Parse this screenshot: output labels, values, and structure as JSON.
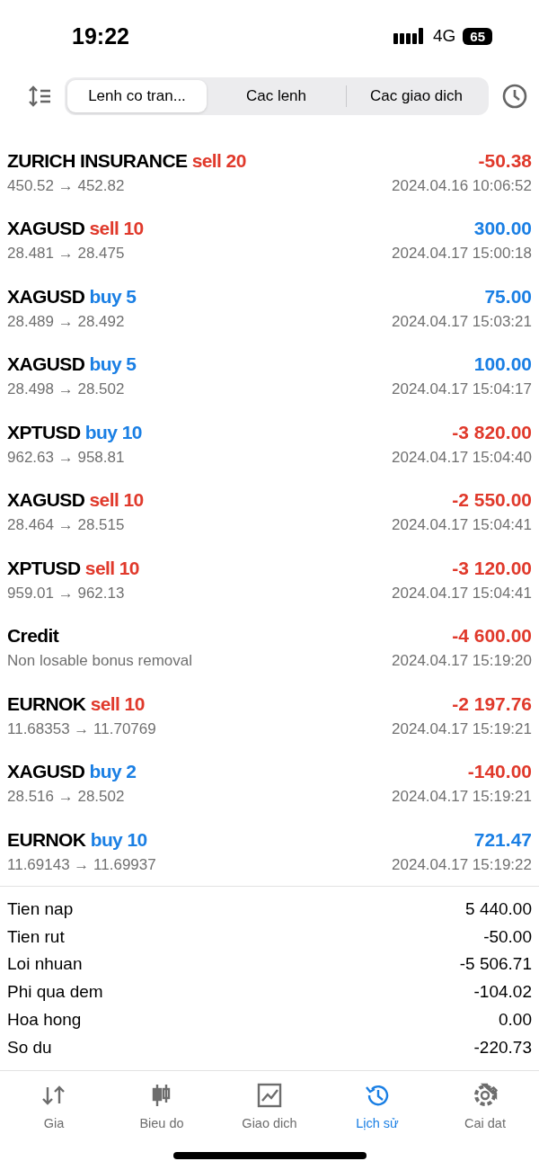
{
  "status_bar": {
    "time": "19:22",
    "network": "4G",
    "battery": "65"
  },
  "segments": [
    {
      "label": "Lenh co tran...",
      "selected": true
    },
    {
      "label": "Cac lenh",
      "selected": false
    },
    {
      "label": "Cac giao dich",
      "selected": false
    }
  ],
  "deals": [
    {
      "kind": "trade",
      "symbol": "ZURICH INSURANCE",
      "side": "sell",
      "volume": "20",
      "detail": "450.52 → 452.82",
      "profit": "-50.38",
      "loss": true,
      "time": "2024.04.16 10:06:52"
    },
    {
      "kind": "trade",
      "symbol": "XAGUSD",
      "side": "sell",
      "volume": "10",
      "detail": "28.481 → 28.475",
      "profit": "300.00",
      "loss": false,
      "time": "2024.04.17 15:00:18"
    },
    {
      "kind": "trade",
      "symbol": "XAGUSD",
      "side": "buy",
      "volume": "5",
      "detail": "28.489 → 28.492",
      "profit": "75.00",
      "loss": false,
      "time": "2024.04.17 15:03:21"
    },
    {
      "kind": "trade",
      "symbol": "XAGUSD",
      "side": "buy",
      "volume": "5",
      "detail": "28.498 → 28.502",
      "profit": "100.00",
      "loss": false,
      "time": "2024.04.17 15:04:17"
    },
    {
      "kind": "trade",
      "symbol": "XPTUSD",
      "side": "buy",
      "volume": "10",
      "detail": "962.63 → 958.81",
      "profit": "-3 820.00",
      "loss": true,
      "time": "2024.04.17 15:04:40"
    },
    {
      "kind": "trade",
      "symbol": "XAGUSD",
      "side": "sell",
      "volume": "10",
      "detail": "28.464 → 28.515",
      "profit": "-2 550.00",
      "loss": true,
      "time": "2024.04.17 15:04:41"
    },
    {
      "kind": "trade",
      "symbol": "XPTUSD",
      "side": "sell",
      "volume": "10",
      "detail": "959.01 → 962.13",
      "profit": "-3 120.00",
      "loss": true,
      "time": "2024.04.17 15:04:41"
    },
    {
      "kind": "credit",
      "symbol": "Credit",
      "detail": "Non losable bonus removal",
      "profit": "-4 600.00",
      "loss": true,
      "time": "2024.04.17 15:19:20"
    },
    {
      "kind": "trade",
      "symbol": "EURNOK",
      "side": "sell",
      "volume": "10",
      "detail": "11.68353 → 11.70769",
      "profit": "-2 197.76",
      "loss": true,
      "time": "2024.04.17 15:19:21"
    },
    {
      "kind": "trade",
      "symbol": "XAGUSD",
      "side": "buy",
      "volume": "2",
      "detail": "28.516 → 28.502",
      "profit": "-140.00",
      "loss": true,
      "time": "2024.04.17 15:19:21"
    },
    {
      "kind": "trade",
      "symbol": "EURNOK",
      "side": "buy",
      "volume": "10",
      "detail": "11.69143 → 11.69937",
      "profit": "721.47",
      "loss": false,
      "time": "2024.04.17 15:19:22"
    }
  ],
  "summary": [
    {
      "label": "Tien nap",
      "value": "5 440.00"
    },
    {
      "label": "Tien rut",
      "value": "-50.00"
    },
    {
      "label": "Loi nhuan",
      "value": "-5 506.71"
    },
    {
      "label": "Phi qua dem",
      "value": "-104.02"
    },
    {
      "label": "Hoa hong",
      "value": "0.00"
    },
    {
      "label": "So du",
      "value": "-220.73"
    }
  ],
  "tab_bar": [
    {
      "kind": "quotes",
      "label": "Gia",
      "selected": false
    },
    {
      "kind": "chart",
      "label": "Bieu do",
      "selected": false
    },
    {
      "kind": "trade",
      "label": "Giao dich",
      "selected": false
    },
    {
      "kind": "history",
      "label": "Lịch sử",
      "selected": true
    },
    {
      "kind": "settings",
      "label": "Cai dat",
      "selected": false
    }
  ]
}
